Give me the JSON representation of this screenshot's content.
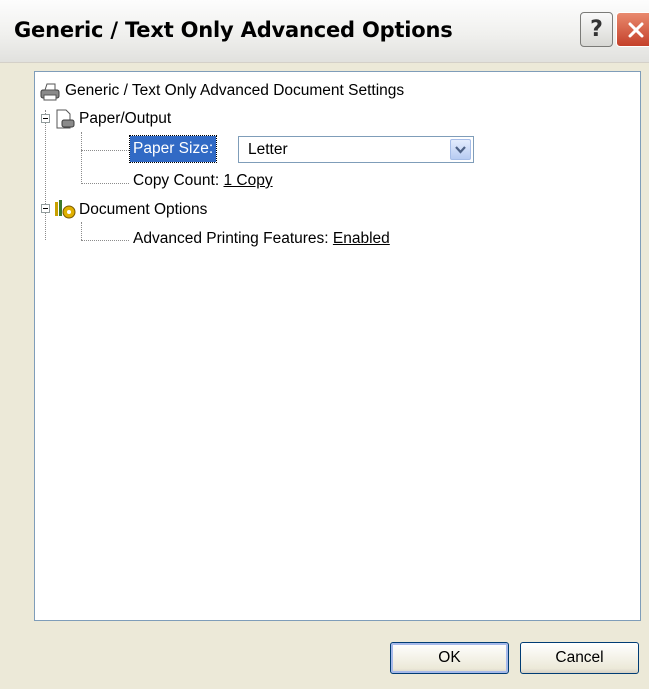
{
  "window": {
    "title": "Generic / Text Only Advanced Options"
  },
  "titlebar": {
    "help_label": "?"
  },
  "tree": {
    "root": "Generic / Text Only Advanced Document Settings",
    "paper_output": {
      "label": "Paper/Output",
      "paper_size_label": "Paper Size:",
      "paper_size_value": "Letter",
      "copy_count_label": "Copy Count:",
      "copy_count_value": "1 Copy"
    },
    "document_options": {
      "label": "Document Options",
      "advanced_label": "Advanced Printing Features:",
      "advanced_value": "Enabled"
    }
  },
  "buttons": {
    "ok": "OK",
    "cancel": "Cancel"
  },
  "colors": {
    "selection": "#316ac5",
    "close": "#c4402a",
    "border": "#7f9db9"
  }
}
